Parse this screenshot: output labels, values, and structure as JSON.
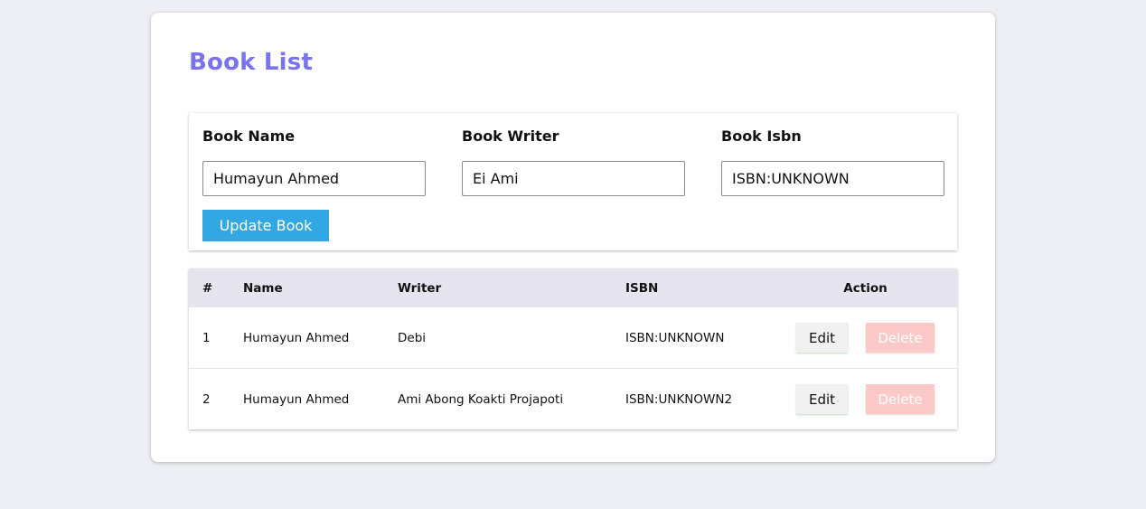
{
  "page": {
    "title": "Book List"
  },
  "form": {
    "name_label": "Book Name",
    "name_value": "Humayun Ahmed",
    "writer_label": "Book Writer",
    "writer_value": "Ei Ami",
    "isbn_label": "Book Isbn",
    "isbn_value": "ISBN:UNKNOWN",
    "submit_label": "Update Book"
  },
  "table": {
    "headers": {
      "num": "#",
      "name": "Name",
      "writer": "Writer",
      "isbn": "ISBN",
      "action": "Action"
    },
    "rows": [
      {
        "num": "1",
        "name": "Humayun Ahmed",
        "writer": "Debi",
        "isbn": "ISBN:UNKNOWN",
        "edit_label": "Edit",
        "delete_label": "Delete"
      },
      {
        "num": "2",
        "name": "Humayun Ahmed",
        "writer": "Ami Abong Koakti Projapoti",
        "isbn": "ISBN:UNKNOWN2",
        "edit_label": "Edit",
        "delete_label": "Delete"
      }
    ]
  },
  "colors": {
    "background": "#eeeff4",
    "title": "#7a72ef",
    "primary_button": "#33a7e4",
    "table_header": "#e6e4ee",
    "delete_button": "#fbcac8",
    "edit_button": "#f1f1f1"
  }
}
